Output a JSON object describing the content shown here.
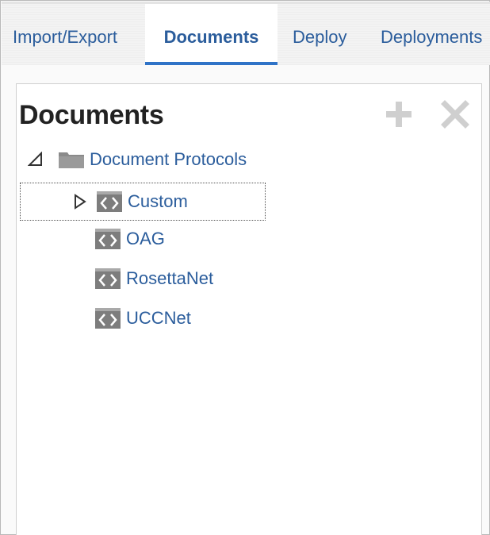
{
  "tabs": [
    {
      "label": "Import/Export",
      "active": false
    },
    {
      "label": "Documents",
      "active": true
    },
    {
      "label": "Deploy",
      "active": false
    },
    {
      "label": "Deployments",
      "active": false
    }
  ],
  "panel": {
    "title": "Documents",
    "toolbar": {
      "add_icon": "plus-icon",
      "remove_icon": "close-icon"
    }
  },
  "tree": {
    "root": {
      "label": "Document Protocols",
      "expanded": true,
      "icon": "folder-icon"
    },
    "children": [
      {
        "label": "Custom",
        "expandable": true,
        "selected": true,
        "icon": "protocol-icon"
      },
      {
        "label": "OAG",
        "expandable": false,
        "icon": "protocol-icon"
      },
      {
        "label": "RosettaNet",
        "expandable": false,
        "icon": "protocol-icon"
      },
      {
        "label": "UCCNet",
        "expandable": false,
        "icon": "protocol-icon"
      }
    ]
  },
  "colors": {
    "link": "#2b5d9c",
    "active_tab_underline": "#2f73c7",
    "disabled_icon": "#cfcfcf",
    "protocol_icon": "#7d7d7d"
  }
}
